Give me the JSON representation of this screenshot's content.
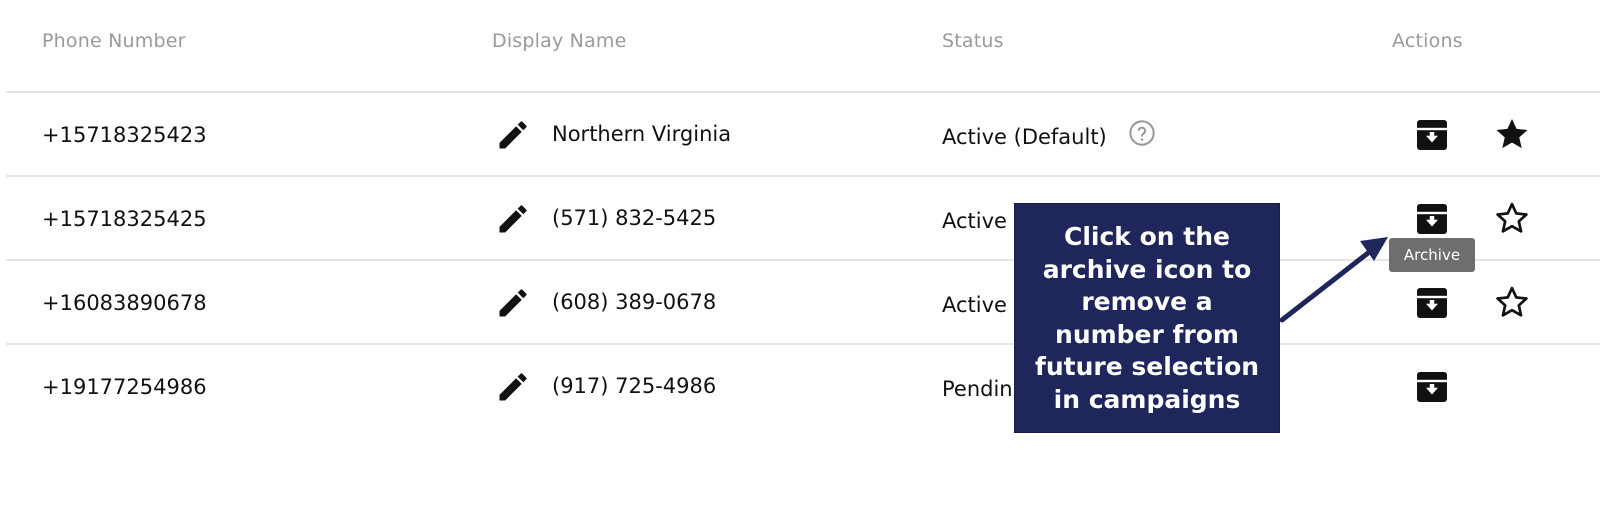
{
  "table": {
    "columns": {
      "phone": "Phone Number",
      "display_name": "Display Name",
      "status": "Status",
      "actions": "Actions"
    },
    "rows": [
      {
        "phone": "+15718325423",
        "display_name": "Northern Virginia",
        "status": "Active (Default)",
        "help_icon": "question-circle-icon",
        "starred": true
      },
      {
        "phone": "+15718325425",
        "display_name": "(571) 832-5425",
        "status": "Active",
        "starred": false
      },
      {
        "phone": "+16083890678",
        "display_name": "(608) 389-0678",
        "status": "Active",
        "starred": false
      },
      {
        "phone": "+19177254986",
        "display_name": "(917) 725-4986",
        "status": "Pendin"
      }
    ]
  },
  "icons": {
    "edit": "pencil-icon",
    "archive": "archive-icon",
    "star_filled": "star-filled-icon",
    "star_outline": "star-outline-icon"
  },
  "tooltip": {
    "text": "Archive"
  },
  "callout": {
    "lines": [
      "Click on the",
      "archive icon to",
      "remove a",
      "number from",
      "future selection",
      "in campaigns"
    ]
  },
  "colors": {
    "callout_bg": "#1f265c",
    "tooltip_bg": "#6e6e6e",
    "header_text": "#9a9a9a",
    "divider": "#e6e6e6"
  }
}
